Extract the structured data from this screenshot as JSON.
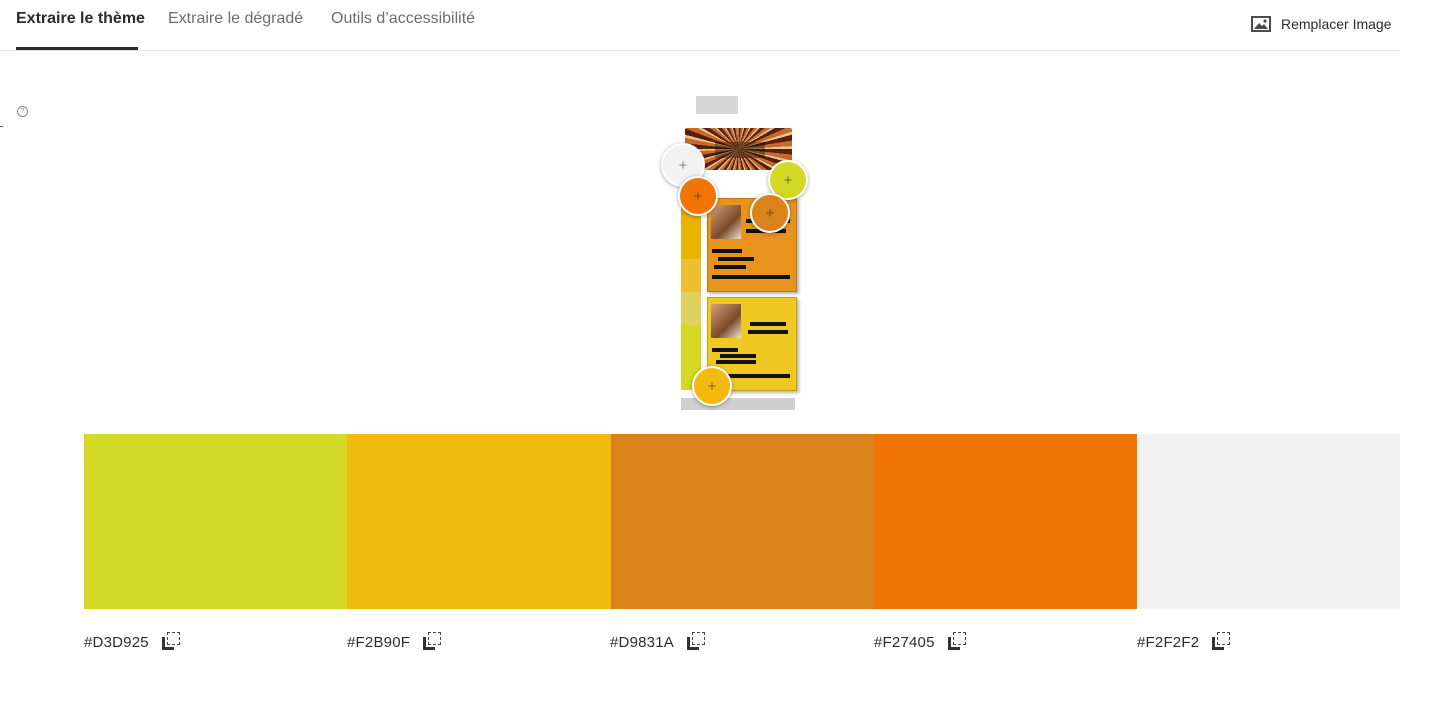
{
  "tabs": [
    {
      "label": "Extraire le thème",
      "active": true
    },
    {
      "label": "Extraire le dégradé",
      "active": false
    },
    {
      "label": "Outils d’accessibilité",
      "active": false
    }
  ],
  "replace_image": {
    "label": "Remplacer Image",
    "icon": "image-icon"
  },
  "help_icon": "question-circle-icon",
  "pickers": [
    {
      "color": "#F2F2F2",
      "icon": "plus-icon"
    },
    {
      "color": "#F27405",
      "icon": "plus-icon"
    },
    {
      "color": "#D3D925",
      "icon": "plus-icon"
    },
    {
      "color": "#D9831A",
      "icon": "plus-icon"
    },
    {
      "color": "#F2B90F",
      "icon": "plus-icon"
    }
  ],
  "swatches": [
    {
      "hex": "#D3D925",
      "color": "#D3D925"
    },
    {
      "hex": "#F2B90F",
      "color": "#F2B90F"
    },
    {
      "hex": "#D9831A",
      "color": "#D9831A"
    },
    {
      "hex": "#F27405",
      "color": "#F27405"
    },
    {
      "hex": "#F2F2F2",
      "color": "#F2F2F2"
    }
  ]
}
